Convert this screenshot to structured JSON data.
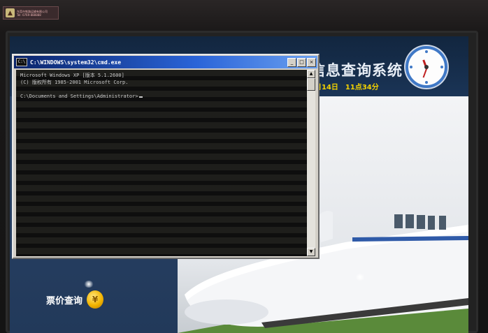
{
  "sticker": {
    "logo": "▲",
    "line1": "东莞市铁路运输有限公司",
    "line2": "Tel: 0769-888888"
  },
  "kiosk": {
    "title": "信息查询系统",
    "date": "月14日",
    "time": "11点34分",
    "fare_button": "票价查询",
    "fare_coin": "¥"
  },
  "cmd": {
    "title": "C:\\WINDOWS\\system32\\cmd.exe",
    "icon_text": "C:\\",
    "controls": {
      "minimize": "_",
      "maximize": "□",
      "close": "×"
    },
    "lines": [
      "Microsoft Windows XP [版本 5.1.2600]",
      "(C) 版权所有 1985-2001 Microsoft Corp.",
      "",
      "C:\\Documents and Settings\\Administrator>"
    ],
    "scroll_up": "▲",
    "scroll_down": "▼"
  },
  "colors": {
    "titlebar_start": "#0a246a",
    "titlebar_end": "#6aa0f0",
    "kiosk_accent": "#f3d200",
    "clock_ring": "#3f78c6"
  },
  "icons": [
    "cmd-app-icon",
    "clock-icon",
    "coin-icon"
  ]
}
